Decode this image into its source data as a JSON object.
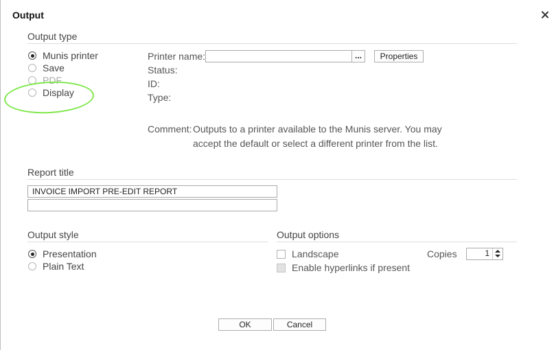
{
  "dialog": {
    "title": "Output"
  },
  "output_type": {
    "heading": "Output type",
    "options": [
      {
        "label": "Munis printer",
        "checked": true
      },
      {
        "label": "Save",
        "checked": false
      },
      {
        "label": "PDF",
        "checked": false
      },
      {
        "label": "Display",
        "checked": false
      }
    ]
  },
  "printer": {
    "name_label": "Printer name:",
    "name_value": "",
    "browse_label": "...",
    "properties_label": "Properties",
    "status_label": "Status:",
    "id_label": "ID:",
    "type_label": "Type:",
    "comment_label": "Comment:",
    "comment_line1": "Outputs to a printer available to the Munis server.  You may",
    "comment_line2": "accept the default or select a different printer from the list."
  },
  "report_title": {
    "heading": "Report title",
    "line1": "INVOICE IMPORT PRE-EDIT REPORT",
    "line2": ""
  },
  "output_style": {
    "heading": "Output style",
    "options": [
      {
        "label": "Presentation",
        "checked": true
      },
      {
        "label": "Plain Text",
        "checked": false
      }
    ]
  },
  "output_options": {
    "heading": "Output options",
    "landscape_label": "Landscape",
    "hyperlinks_label": "Enable hyperlinks if present",
    "copies_label": "Copies",
    "copies_value": "1"
  },
  "footer": {
    "ok_label": "OK",
    "cancel_label": "Cancel"
  },
  "colors": {
    "annotation": "#7ee74a"
  }
}
